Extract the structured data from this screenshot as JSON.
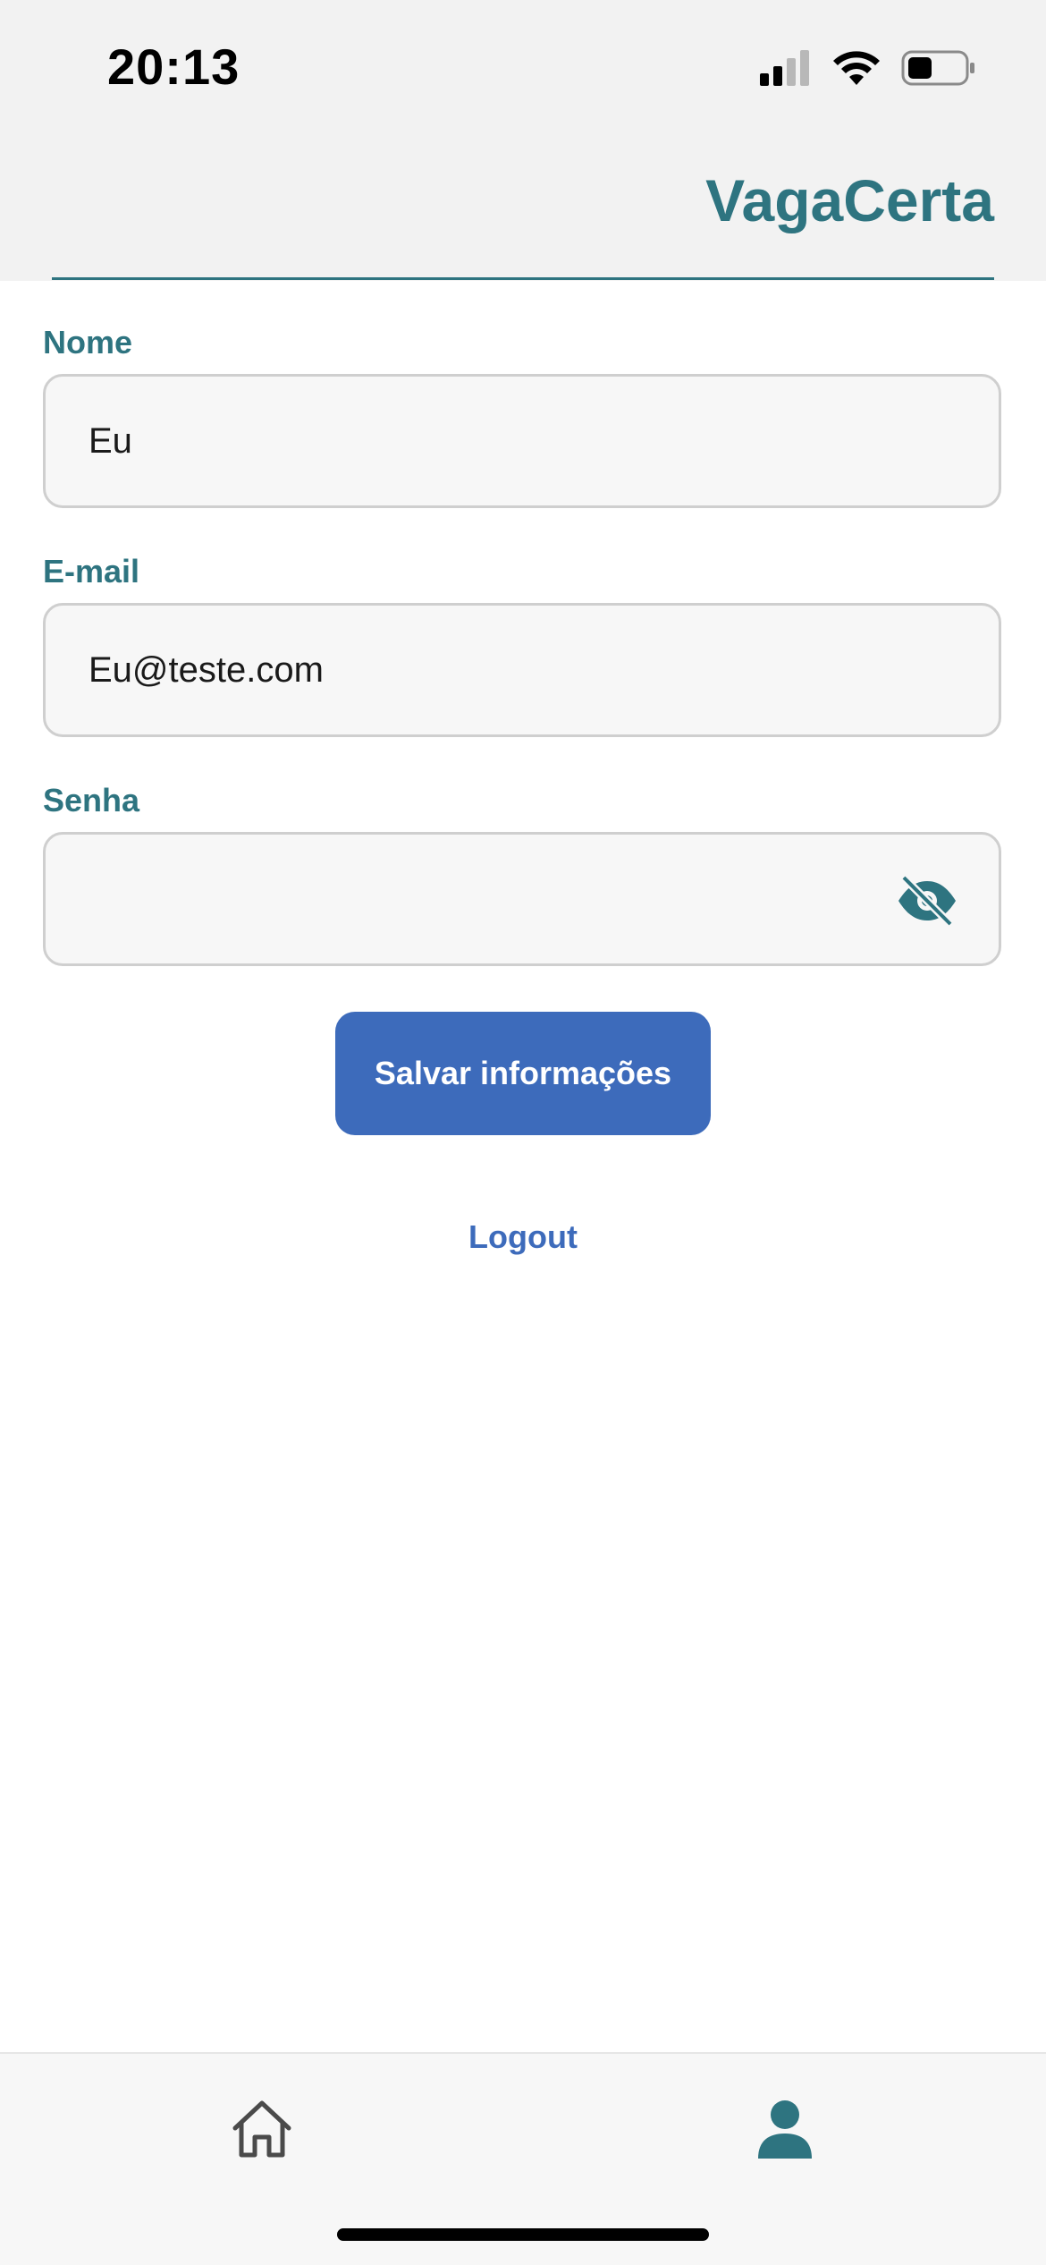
{
  "status_bar": {
    "time": "20:13",
    "icons": [
      "cellular-signal-icon",
      "wifi-icon",
      "battery-icon"
    ]
  },
  "header": {
    "brand": "VagaCerta"
  },
  "form": {
    "name_label": "Nome",
    "name_value": "Eu",
    "email_label": "E-mail",
    "email_value": "Eu@teste.com",
    "password_label": "Senha",
    "password_value": "",
    "password_toggle_icon": "eye-off-icon"
  },
  "actions": {
    "save_label": "Salvar informações",
    "logout_label": "Logout"
  },
  "tabbar": {
    "items": [
      {
        "icon": "home-icon",
        "active": false
      },
      {
        "icon": "person-icon",
        "active": true
      }
    ]
  },
  "colors": {
    "brand": "#2e7480",
    "button": "#3d6bbb",
    "link": "#3d6bbb",
    "field_bg": "#f7f7f7",
    "field_border": "#cfcfcf",
    "header_bg": "#f2f2f2"
  }
}
